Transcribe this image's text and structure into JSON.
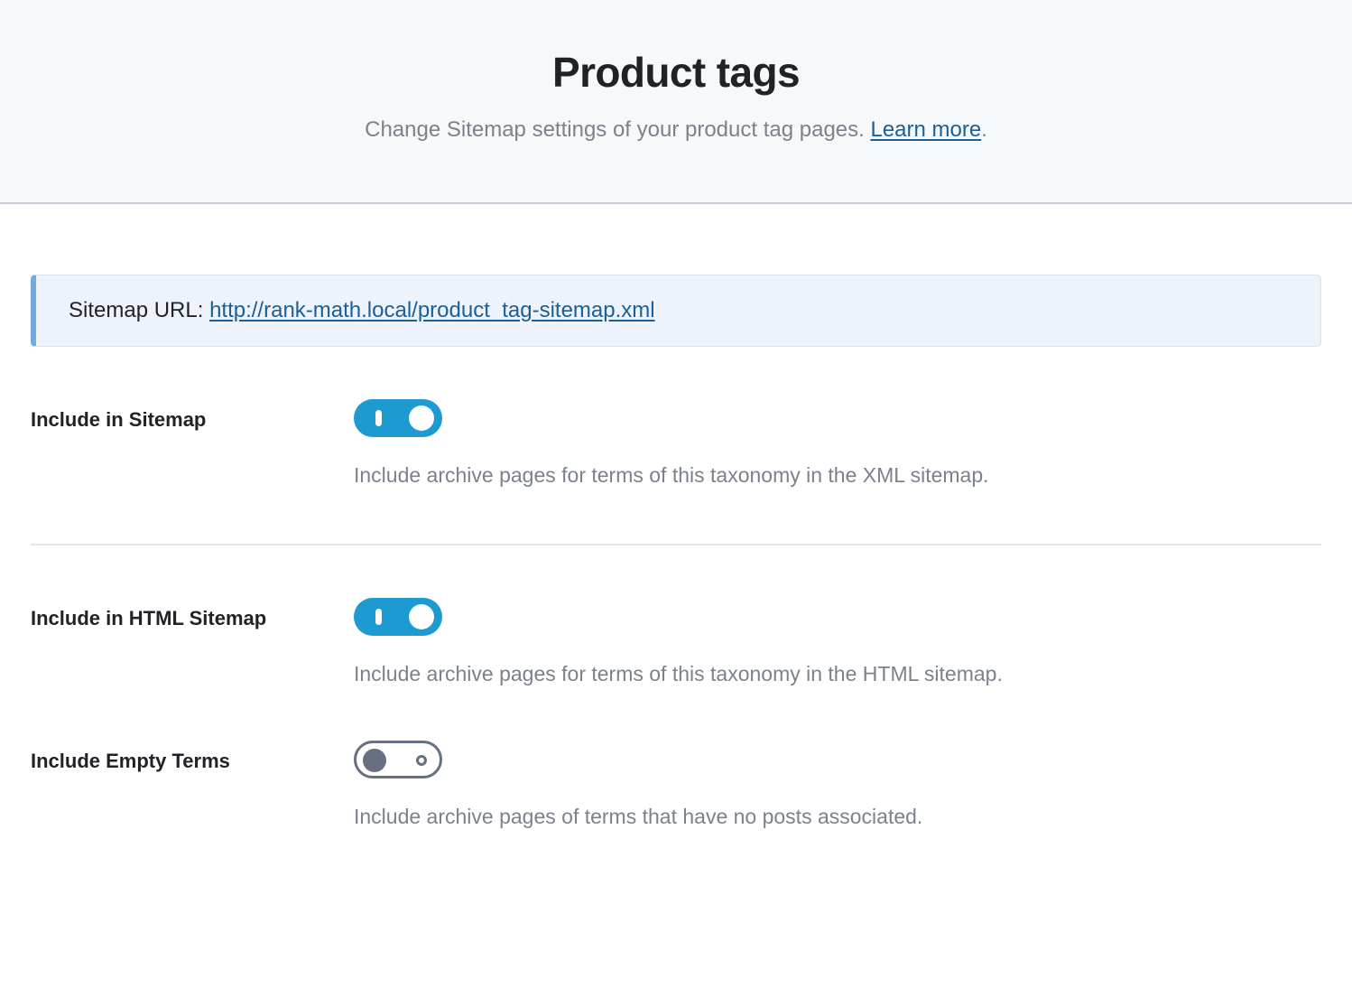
{
  "header": {
    "title": "Product tags",
    "subtitle_prefix": "Change Sitemap settings of your product tag pages. ",
    "subtitle_link": "Learn more",
    "subtitle_suffix": ".",
    "background_color": "#f7f8fa",
    "link_color": "#1a5f96"
  },
  "notice": {
    "label": "Sitemap URL: ",
    "url_text": "http://rank-math.local/product_tag-sitemap.xml",
    "accent_color": "#72a9e0",
    "background_color": "#eef3fb"
  },
  "settings": [
    {
      "label": "Include in Sitemap",
      "toggle_state": "on",
      "toggle_name": "include-in-sitemap-toggle",
      "description": "Include archive pages for terms of this taxonomy in the XML sitemap."
    },
    {
      "label": "Include in HTML Sitemap",
      "toggle_state": "on",
      "toggle_name": "include-in-html-sitemap-toggle",
      "description": "Include archive pages for terms of this taxonomy in the HTML sitemap."
    },
    {
      "label": "Include Empty Terms",
      "toggle_state": "off",
      "toggle_name": "include-empty-terms-toggle",
      "description": "Include archive pages of terms that have no posts associated."
    }
  ],
  "colors": {
    "toggle_on": "#1d9bd1",
    "toggle_off_border": "#667080",
    "divider": "#e3e5e9",
    "text_primary": "#1f2327",
    "text_muted": "#7b828c"
  }
}
